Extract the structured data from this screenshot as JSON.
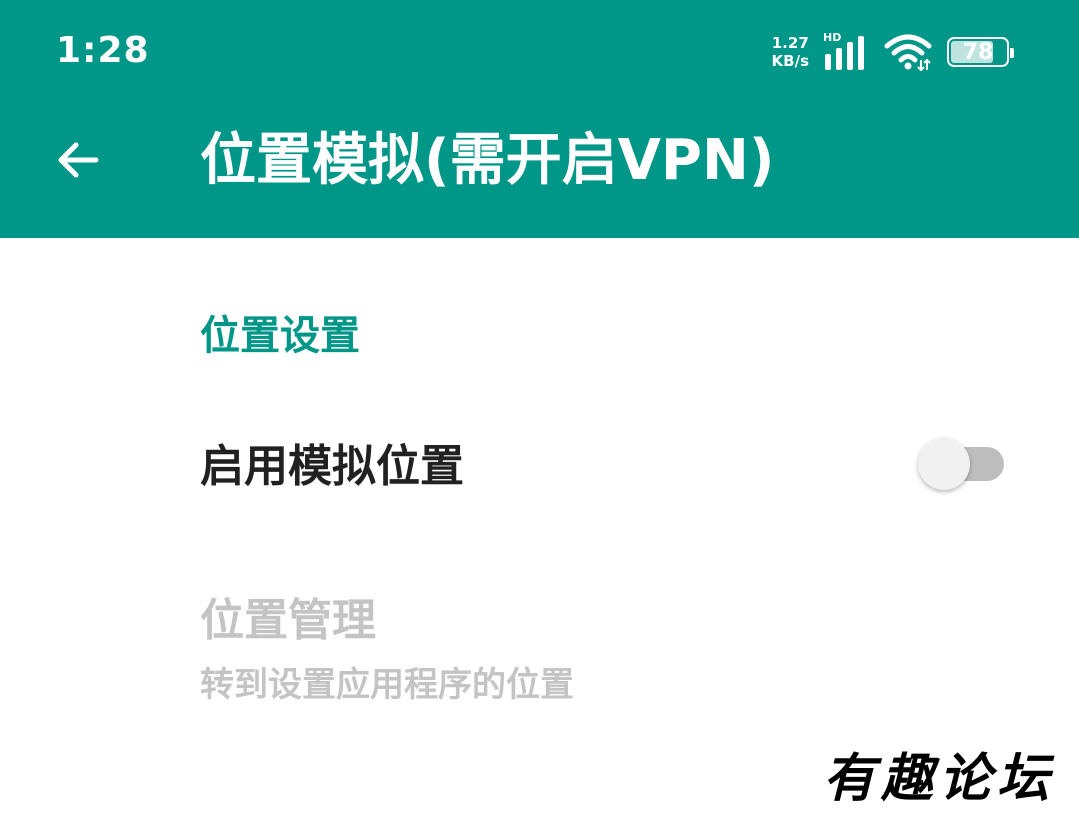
{
  "status_bar": {
    "time": "1:28",
    "net_speed_value": "1.27",
    "net_speed_unit": "KB/s",
    "network_label": "HD",
    "battery_level": "78",
    "icons": [
      "signal-icon",
      "wifi-icon",
      "battery-icon"
    ]
  },
  "app_bar": {
    "back_icon": "arrow-back-icon",
    "title": "位置模拟(需开启VPN)",
    "color": "#009688"
  },
  "settings": {
    "section_header": "位置设置",
    "enable_mock_location": {
      "label": "启用模拟位置",
      "checked": false
    },
    "location_management": {
      "label": "位置管理",
      "summary": "转到设置应用程序的位置",
      "enabled": false
    }
  },
  "watermark": "有趣论坛",
  "colors": {
    "accent": "#009688",
    "text_primary": "#212121",
    "text_disabled": "#c4c4c4",
    "switch_track_off": "#bdbdbd",
    "switch_thumb_off": "#f1f1f1"
  }
}
